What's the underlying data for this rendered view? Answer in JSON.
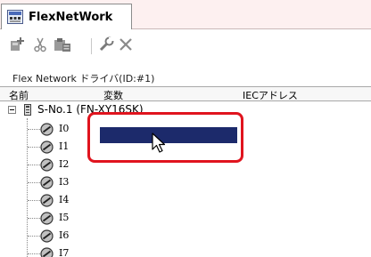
{
  "tab": {
    "title": "FlexNetWork",
    "icon": "flexnetwork-tab-icon"
  },
  "toolbar": {
    "buttons": [
      {
        "name": "add-node-icon"
      },
      {
        "name": "cut-icon"
      },
      {
        "name": "paste-icon"
      },
      {
        "name": "settings-icon"
      },
      {
        "name": "delete-icon"
      }
    ]
  },
  "driver": {
    "title": "Flex Network ドライバ(ID:#1)"
  },
  "columns": {
    "name": "名前",
    "variable": "変数",
    "iec": "IECアドレス"
  },
  "tree": {
    "root": {
      "label": "S-No.1 (FN-XY16SK)"
    },
    "items": [
      "I0",
      "I1",
      "I2",
      "I3",
      "I4",
      "I5",
      "I6",
      "I7"
    ]
  },
  "colors": {
    "selection": "#1c2a6b",
    "highlight": "#e0141e"
  }
}
